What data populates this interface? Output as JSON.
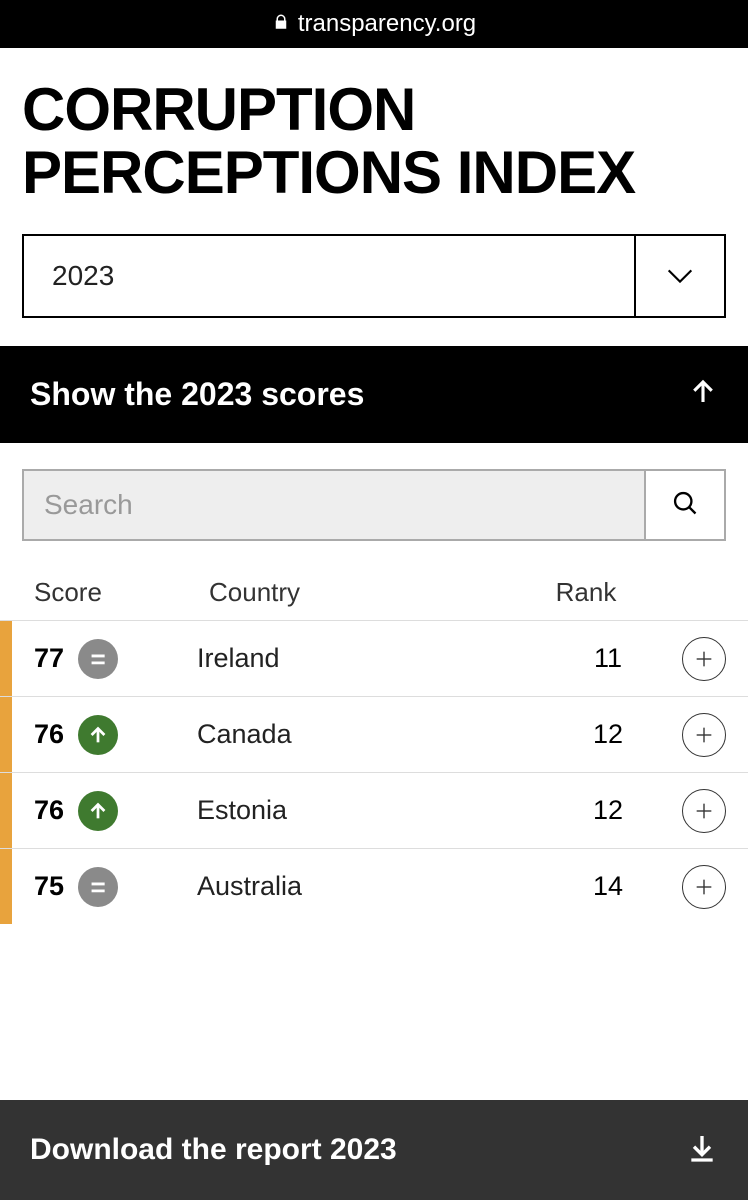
{
  "url": "transparency.org",
  "title": "CORRUPTION PERCEPTIONS INDEX",
  "year_select": {
    "value": "2023"
  },
  "toggle": {
    "label": "Show the 2023 scores"
  },
  "search": {
    "placeholder": "Search"
  },
  "table": {
    "headers": {
      "score": "Score",
      "country": "Country",
      "rank": "Rank"
    },
    "rows": [
      {
        "score": "77",
        "trend": "same",
        "country": "Ireland",
        "rank": "11"
      },
      {
        "score": "76",
        "trend": "up",
        "country": "Canada",
        "rank": "12"
      },
      {
        "score": "76",
        "trend": "up",
        "country": "Estonia",
        "rank": "12"
      },
      {
        "score": "75",
        "trend": "same",
        "country": "Australia",
        "rank": "14"
      }
    ]
  },
  "download": {
    "label": "Download the report 2023"
  }
}
